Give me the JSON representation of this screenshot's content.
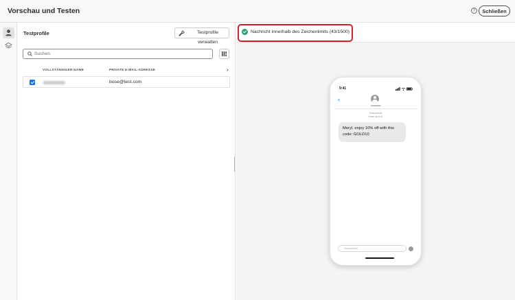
{
  "header": {
    "title": "Vorschau und Testen",
    "help_icon": "help-circle-icon",
    "help_glyph": "?",
    "close_label": "Schließen"
  },
  "rail": {
    "items": [
      {
        "icon": "user-icon",
        "active": true
      },
      {
        "icon": "layers-icon",
        "active": false
      }
    ]
  },
  "profiles": {
    "title": "Testprofile",
    "manage_label": "Testprofile verwalten",
    "manage_icon": "wrench-icon",
    "search_placeholder": "Suchen",
    "columns_icon": "column-settings-icon",
    "columns": [
      "VOLLSTÄNDIGER NAME",
      "PRIVATE E-MAIL-ADRESSE"
    ],
    "more_columns_glyph": "›",
    "rows": [
      {
        "checked": true,
        "name_redacted": true,
        "email": "bose@test.com"
      }
    ]
  },
  "preview": {
    "status_icon": "check-circle-icon",
    "status_color": "#2d9d78",
    "status_text": "Nachricht innerhalb des Zeichenlimits (43/1500)",
    "highlight_color": "#d31f2a",
    "phone": {
      "time": "9:41",
      "sender_number": "123456994",
      "meta_line1": "Textnachricht",
      "meta_line2": "Heute um 9:41",
      "back_glyph": "‹",
      "message": "Meryl, enjoy 10% off with this code: GOLD10",
      "input_placeholder": "Textnachricht"
    }
  }
}
